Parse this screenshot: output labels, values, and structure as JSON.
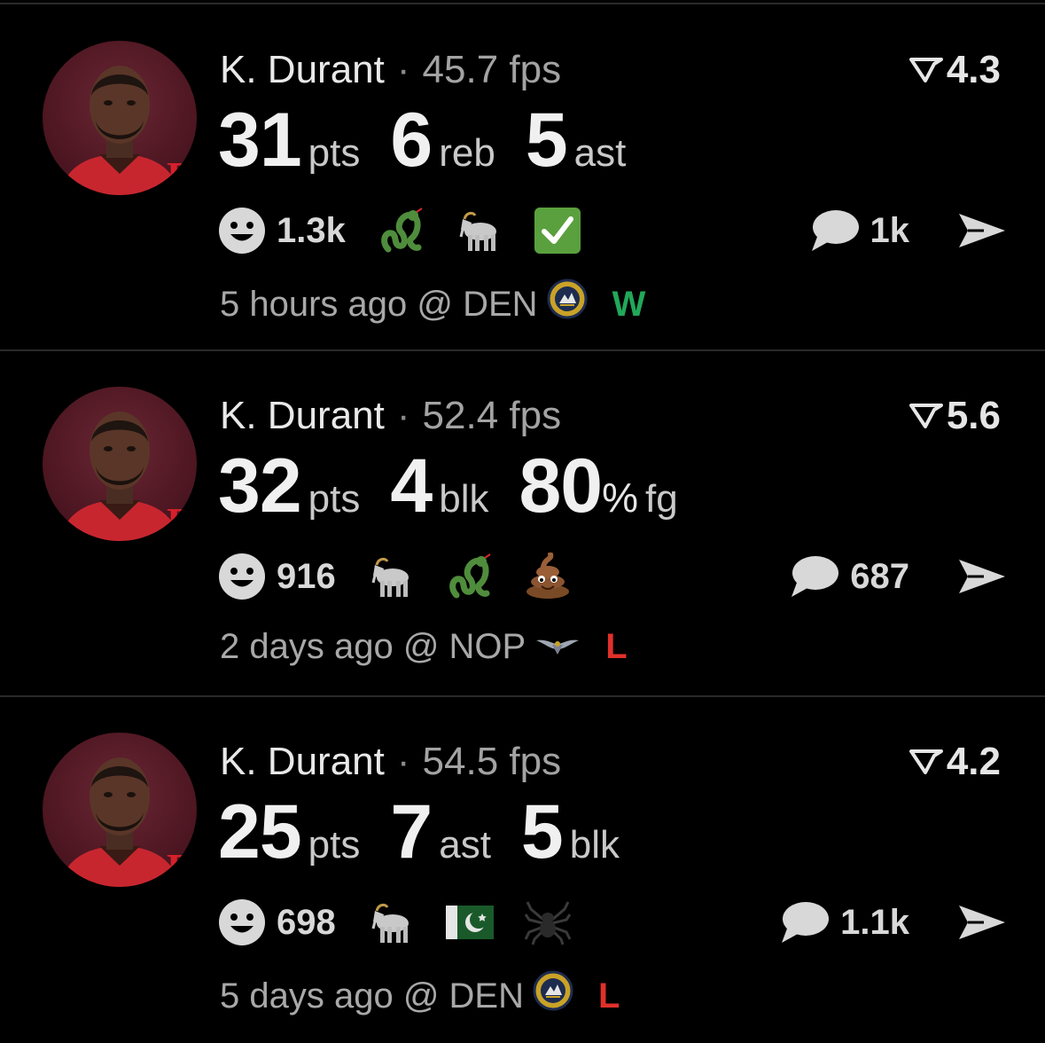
{
  "colors": {
    "win": "#22a85a",
    "loss": "#e0302b",
    "background": "#000000"
  },
  "cards": [
    {
      "player": "K. Durant",
      "fps": "45.7 fps",
      "rating": "4.3",
      "stats": [
        {
          "value": "31",
          "unit": "pts"
        },
        {
          "value": "6",
          "unit": "reb"
        },
        {
          "value": "5",
          "unit": "ast"
        }
      ],
      "reaction_count": "1.3k",
      "emojis": [
        "snake-icon",
        "goat-icon",
        "check-mark-icon"
      ],
      "comment_count": "1k",
      "time": "5 hours ago @ DEN",
      "opponent_logo": "nuggets-logo-icon",
      "result": "W"
    },
    {
      "player": "K. Durant",
      "fps": "52.4 fps",
      "rating": "5.6",
      "stats": [
        {
          "value": "32",
          "unit": "pts"
        },
        {
          "value": "4",
          "unit": "blk"
        },
        {
          "value": "80",
          "pct": "%",
          "unit": "fg"
        }
      ],
      "reaction_count": "916",
      "emojis": [
        "goat-icon",
        "snake-icon",
        "poop-icon"
      ],
      "comment_count": "687",
      "time": "2 days ago @ NOP",
      "opponent_logo": "pelicans-logo-icon",
      "result": "L"
    },
    {
      "player": "K. Durant",
      "fps": "54.5 fps",
      "rating": "4.2",
      "stats": [
        {
          "value": "25",
          "unit": "pts"
        },
        {
          "value": "7",
          "unit": "ast"
        },
        {
          "value": "5",
          "unit": "blk"
        }
      ],
      "reaction_count": "698",
      "emojis": [
        "goat-icon",
        "pakistan-flag-icon",
        "spider-icon"
      ],
      "comment_count": "1.1k",
      "time": "5 days ago @ DEN",
      "opponent_logo": "nuggets-logo-icon",
      "result": "L"
    }
  ]
}
